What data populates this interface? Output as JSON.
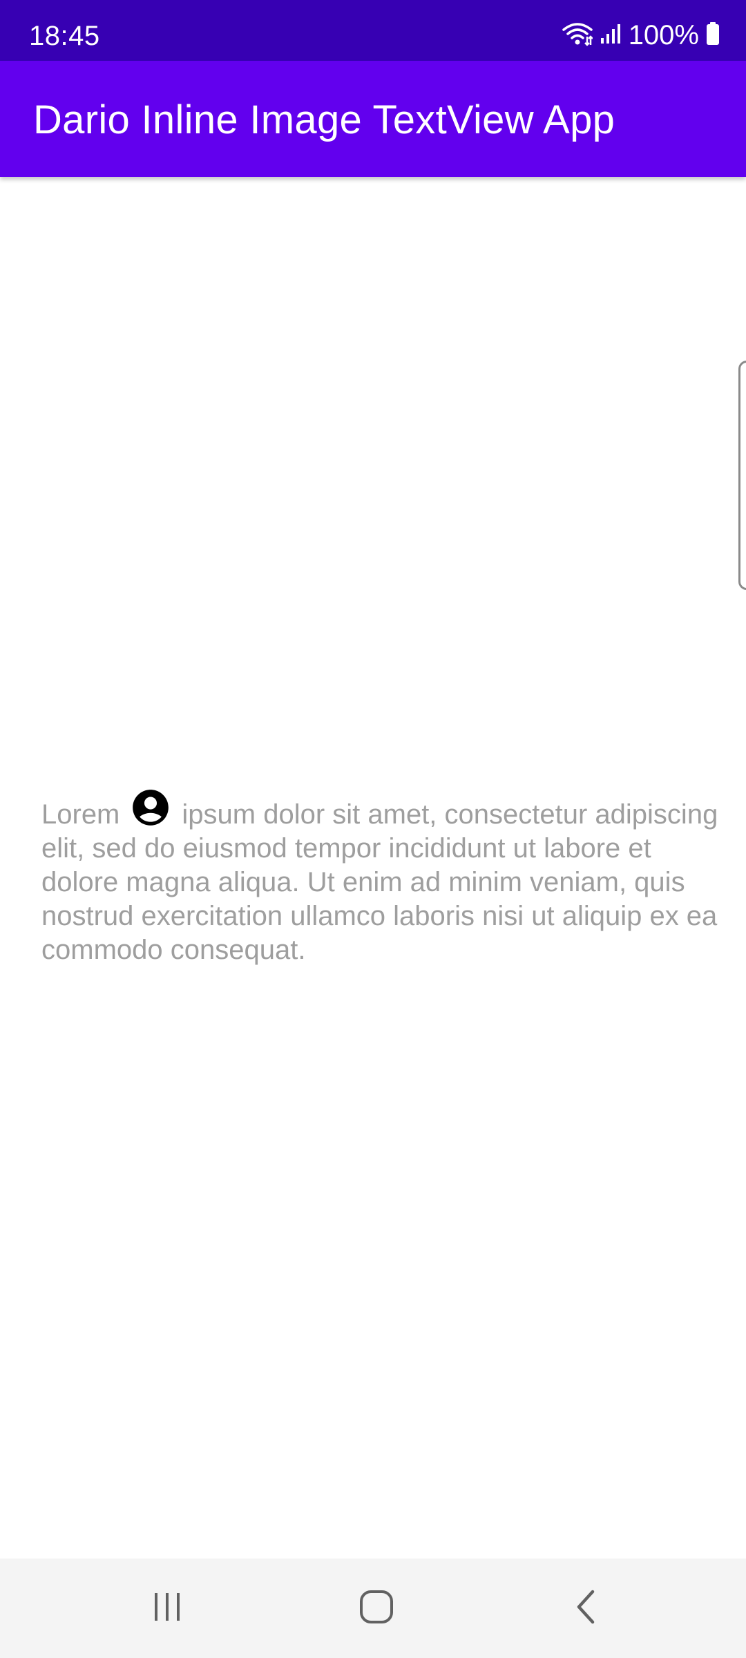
{
  "status_bar": {
    "time": "18:45",
    "battery_text": "100%",
    "icons": [
      "wifi-icon",
      "signal-icon",
      "battery-icon"
    ]
  },
  "app_bar": {
    "title": "Dario Inline Image TextView App"
  },
  "content": {
    "text_before_image": "Lorem",
    "inline_image": "account-circle-icon",
    "text_after_image": "ipsum dolor sit amet, consectetur adipiscing elit, sed do eiusmod tempor incididunt ut labore et dolore magna aliqua. Ut enim ad minim veniam, quis nostrud exercitation ullamco laboris nisi ut aliquip ex ea commodo consequat."
  },
  "nav_bar": {
    "buttons": [
      "recents-icon",
      "home-icon",
      "back-icon"
    ]
  },
  "colors": {
    "status_bar": "#3700b3",
    "app_bar": "#6200ee",
    "body_text": "#9e9e9e",
    "nav_bar": "#f4f4f4"
  }
}
